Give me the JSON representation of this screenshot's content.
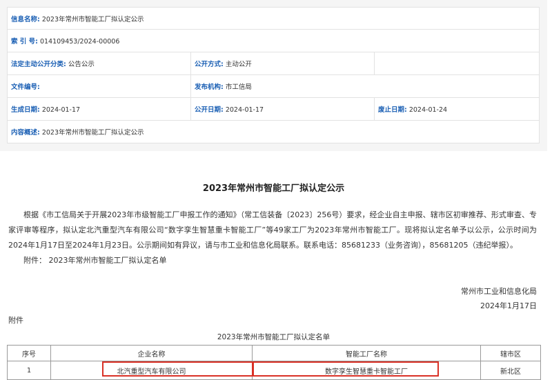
{
  "meta": {
    "info_name_label": "信息名称:",
    "info_name_value": "2023年常州市智能工厂拟认定公示",
    "index_label": "索 引 号:",
    "index_value": "014109453/2024-00006",
    "category_label": "法定主动公开分类:",
    "category_value": "公告公示",
    "method_label": "公开方式:",
    "method_value": "主动公开",
    "doc_no_label": "文件编号:",
    "doc_no_value": "",
    "publisher_label": "发布机构:",
    "publisher_value": "市工信局",
    "created_label": "生成日期:",
    "created_value": "2024-01-17",
    "public_date_label": "公开日期:",
    "public_date_value": "2024-01-17",
    "expiry_label": "废止日期:",
    "expiry_value": "2024-01-24",
    "summary_label": "内容概述:",
    "summary_value": "2023年常州市智能工厂拟认定公示"
  },
  "article": {
    "title": "2023年常州市智能工厂拟认定公示",
    "paragraph": "根据《市工信局关于开展2023年市级智能工厂申报工作的通知》（常工信装备〔2023〕256号）要求，经企业自主申报、辖市区初审推荐、形式审查、专家评审等程序，拟认定北汽重型汽车有限公司“数字孪生智慧重卡智能工厂”等49家工厂为2023年常州市智能工厂。现将拟认定名单予以公示，公示时间为2024年1月17日至2024年1月23日。公示期间如有异议，请与市工业和信息化局联系。联系电话：85681233（业务咨询），85681205（违纪举报）。",
    "attachment_line": "附件： 2023年常州市智能工厂拟认定名单",
    "signer": "常州市工业和信息化局",
    "sign_date": "2024年1月17日",
    "fujian": "附件"
  },
  "list": {
    "title": "2023年常州市智能工厂拟认定名单",
    "headers": [
      "序号",
      "企业名称",
      "智能工厂名称",
      "辖市区"
    ],
    "rows": [
      [
        "1",
        "北汽重型汽车有限公司",
        "数字孪生智慧重卡智能工厂",
        "新北区"
      ]
    ],
    "highlight_color": "#d93025"
  },
  "colors": {
    "label_blue": "#1a5fb4",
    "panel_bg": "#f5f5f5"
  }
}
